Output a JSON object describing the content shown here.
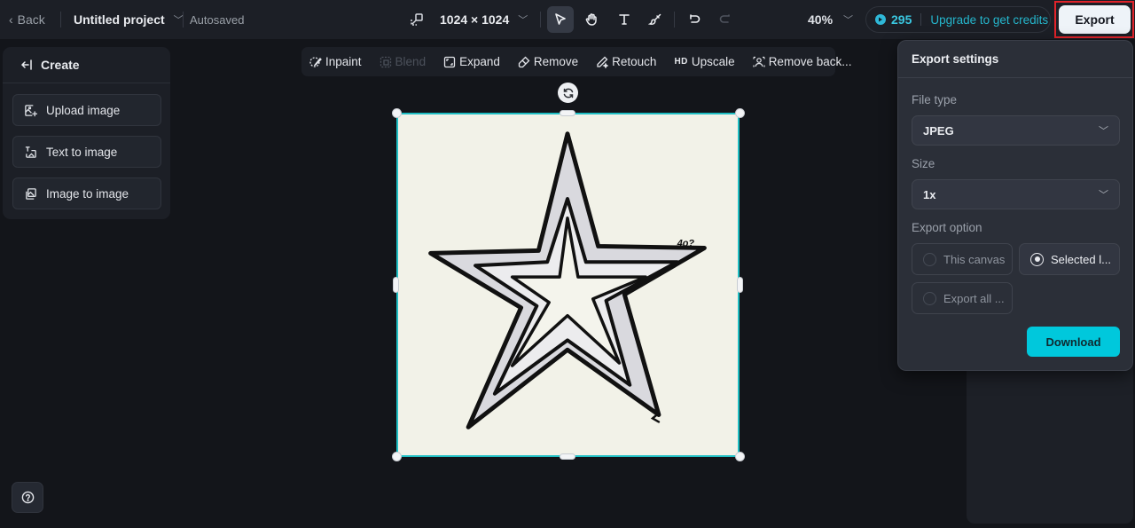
{
  "topbar": {
    "back_label": "Back",
    "project_title": "Untitled project",
    "save_status": "Autosaved",
    "canvas_size": "1024 × 1024",
    "zoom_level": "40%",
    "credits_count": "295",
    "upgrade_label": "Upgrade to get credits",
    "export_label": "Export",
    "tools": [
      {
        "name": "select",
        "icon": "cursor-arrow-icon",
        "active": true
      },
      {
        "name": "hand",
        "icon": "hand-icon",
        "active": false
      },
      {
        "name": "text",
        "icon": "text-icon",
        "active": false
      },
      {
        "name": "brush",
        "icon": "brush-icon",
        "active": false
      },
      {
        "name": "undo",
        "icon": "undo-icon",
        "active": false
      },
      {
        "name": "redo",
        "icon": "redo-icon",
        "active": false,
        "disabled": true
      }
    ]
  },
  "left_panel": {
    "header": "Create",
    "items": [
      {
        "label": "Upload image",
        "icon": "upload-image-icon"
      },
      {
        "label": "Text to image",
        "icon": "text-to-image-icon"
      },
      {
        "label": "Image to image",
        "icon": "image-to-image-icon"
      }
    ]
  },
  "edit_toolbar": {
    "items": [
      {
        "label": "Inpaint",
        "icon": "inpaint-icon",
        "disabled": false
      },
      {
        "label": "Blend",
        "icon": "blend-icon",
        "disabled": true
      },
      {
        "label": "Expand",
        "icon": "expand-icon",
        "disabled": false
      },
      {
        "label": "Remove",
        "icon": "eraser-icon",
        "disabled": false
      },
      {
        "label": "Retouch",
        "icon": "retouch-icon",
        "disabled": false
      },
      {
        "label": "Upscale",
        "icon": "hd-icon",
        "icon_text": "HD",
        "disabled": false
      },
      {
        "label": "Remove back...",
        "icon": "remove-background-icon",
        "disabled": false
      }
    ]
  },
  "canvas": {
    "image_description": "Hand-drawn nested outline star",
    "signature": "4o?",
    "selection_color": "#1fbfc4"
  },
  "export_panel": {
    "title": "Export settings",
    "file_type_label": "File type",
    "file_type_value": "JPEG",
    "size_label": "Size",
    "size_value": "1x",
    "export_option_label": "Export option",
    "options": [
      {
        "label": "This canvas",
        "selected": false
      },
      {
        "label": "Selected l...",
        "selected": true
      },
      {
        "label": "Export all ...",
        "selected": false
      }
    ],
    "download_label": "Download",
    "accent_color": "#00c8dc"
  },
  "colors": {
    "background": "#13151a",
    "panel": "#1c1f26",
    "highlight_border": "#e0232a",
    "credits_accent": "#25b6cc"
  }
}
